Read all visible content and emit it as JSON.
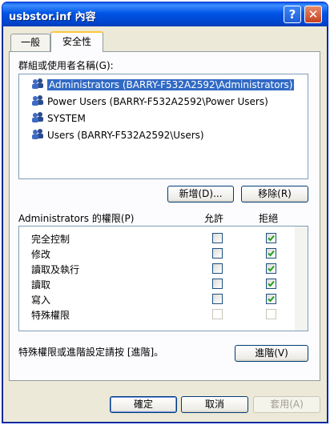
{
  "window": {
    "title": "usbstor.inf 內容",
    "help_label": "?",
    "close_label": "✕"
  },
  "tabs": [
    {
      "label": "一般"
    },
    {
      "label": "安全性"
    }
  ],
  "groups": {
    "label": "群組或使用者名稱(G):",
    "items": [
      {
        "name": "Administrators (BARRY-F532A2592\\Administrators)",
        "selected": true
      },
      {
        "name": "Power Users (BARRY-F532A2592\\Power Users)"
      },
      {
        "name": "SYSTEM"
      },
      {
        "name": "Users (BARRY-F532A2592\\Users)"
      }
    ],
    "add_label": "新增(D)...",
    "remove_label": "移除(R)"
  },
  "permissions": {
    "label": "Administrators 的權限(P)",
    "allow_header": "允許",
    "deny_header": "拒絕",
    "rows": [
      {
        "name": "完全控制",
        "allow": false,
        "deny": true
      },
      {
        "name": "修改",
        "allow": false,
        "deny": true
      },
      {
        "name": "讀取及執行",
        "allow": false,
        "deny": true
      },
      {
        "name": "讀取",
        "allow": false,
        "deny": true
      },
      {
        "name": "寫入",
        "allow": false,
        "deny": true
      },
      {
        "name": "特殊權限",
        "allow": false,
        "deny": false,
        "disabled": true
      }
    ]
  },
  "advanced": {
    "note": "特殊權限或進階設定請按 [進階]。",
    "button_label": "進階(V)"
  },
  "footer": {
    "ok_label": "確定",
    "cancel_label": "取消",
    "apply_label": "套用(A)"
  },
  "colors": {
    "title_bar": "#0055e5",
    "selection": "#316ac5",
    "check": "#21a121"
  }
}
